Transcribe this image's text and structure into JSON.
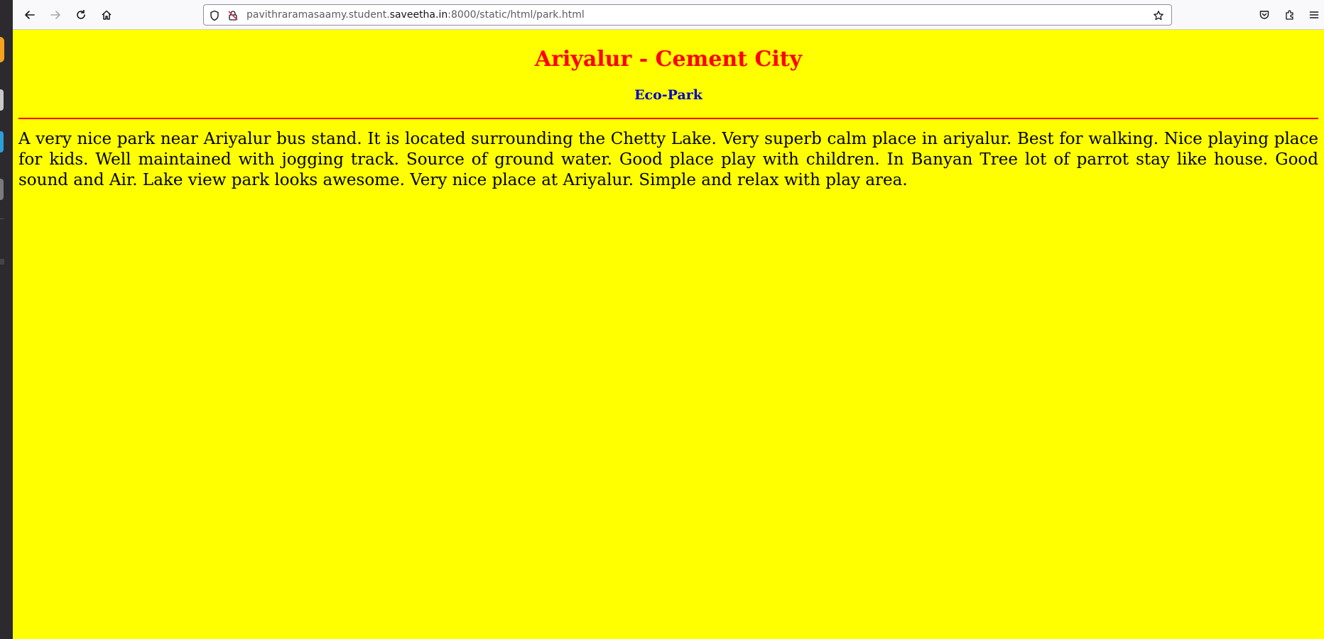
{
  "browser": {
    "url": {
      "prefix": "pavithraramasaamy.student.",
      "domain": "saveetha.in",
      "suffix": ":8000/static/html/park.html"
    },
    "icons": {
      "back": "back-arrow-icon",
      "forward": "forward-arrow-icon",
      "reload": "reload-icon",
      "home": "home-icon",
      "tracking": "shield-icon",
      "insecure": "insecure-lock-icon",
      "bookmark": "star-icon",
      "pocket": "pocket-icon",
      "extensions": "extensions-icon",
      "menu": "hamburger-menu-icon"
    }
  },
  "page": {
    "title": "Ariyalur - Cement City",
    "subtitle": "Eco-Park",
    "paragraph": "A very nice park near Ariyalur bus stand. It is located surrounding the Chetty Lake. Very superb calm place in ariyalur. Best for walking. Nice playing place for kids. Well maintained with jogging track. Source of ground water. Good place play with children. In Banyan Tree lot of parrot stay like house. Good sound and Air. Lake view park looks awesome. Very nice place at Ariyalur. Simple and relax with play area."
  },
  "colors": {
    "page_background": "#ffff00",
    "title": "#ff0000",
    "subtitle": "#0000cc",
    "rule": "#ff0000",
    "text": "#000000"
  }
}
